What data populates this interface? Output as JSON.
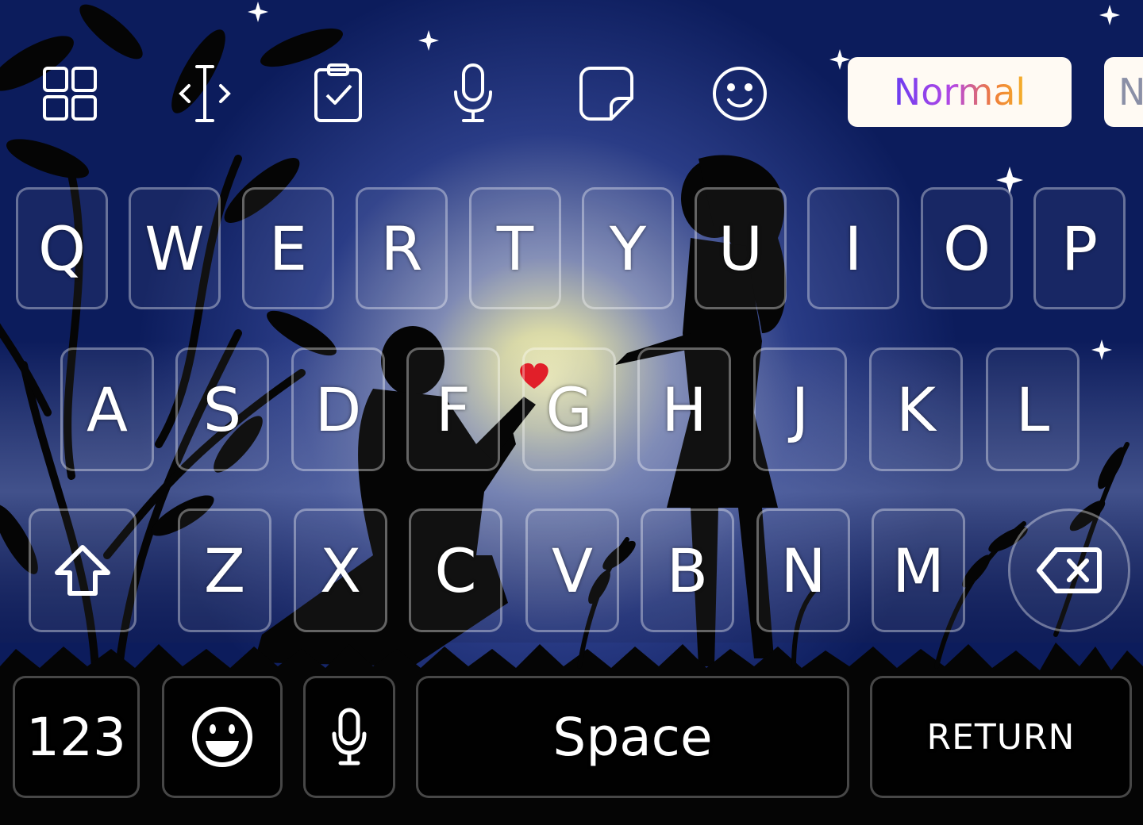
{
  "toolbar": {
    "icons": [
      "grid-icon",
      "cursor-move-icon",
      "clipboard-icon",
      "microphone-icon",
      "sticker-icon",
      "smiley-icon"
    ],
    "styles": [
      "Normal",
      "N"
    ],
    "style_gradient": [
      "#6b3df0",
      "#b447e4",
      "#f07c3a",
      "#f4b22a"
    ]
  },
  "keyboard": {
    "row1": [
      "Q",
      "W",
      "E",
      "R",
      "T",
      "Y",
      "U",
      "I",
      "O",
      "P"
    ],
    "row2": [
      "A",
      "S",
      "D",
      "F",
      "G",
      "H",
      "J",
      "K",
      "L"
    ],
    "row3": [
      "Z",
      "X",
      "C",
      "V",
      "B",
      "N",
      "M"
    ],
    "shift_icon": "shift-icon",
    "backspace_icon": "backspace-icon",
    "numbers_label": "123",
    "emoji_icon": "emoji-icon",
    "mic_icon": "microphone-icon",
    "space_label": "Space",
    "return_label": "RETURN"
  },
  "theme": {
    "sky": "#0c1c5c",
    "moon_glow": "#f2f0b0",
    "heart": "#e0141e",
    "silhouette": "#050505"
  }
}
